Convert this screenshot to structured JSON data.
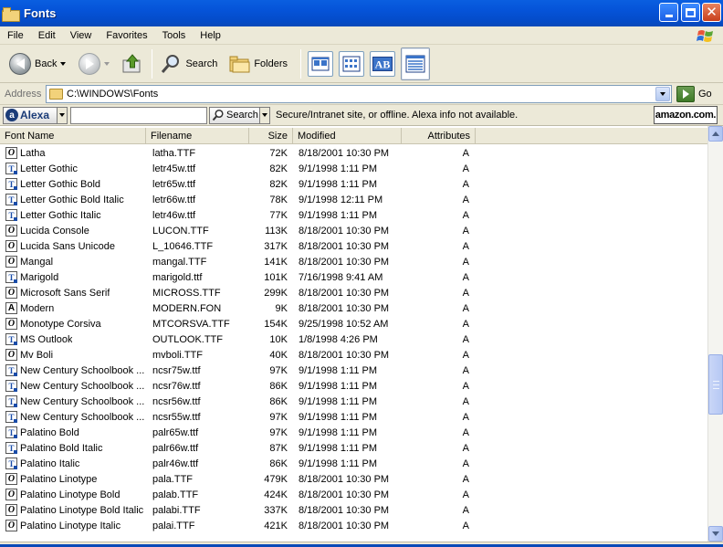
{
  "window": {
    "title": "Fonts"
  },
  "menu": [
    "File",
    "Edit",
    "View",
    "Favorites",
    "Tools",
    "Help"
  ],
  "toolbar": {
    "back_label": "Back",
    "search_label": "Search",
    "folders_label": "Folders"
  },
  "address": {
    "label": "Address",
    "path": "C:\\WINDOWS\\Fonts",
    "go_label": "Go"
  },
  "alexa": {
    "brand": "Alexa",
    "search_placeholder": "",
    "search_label": "Search",
    "status": "Secure/Intranet site, or offline. Alexa info not available.",
    "amazon": "amazon.com."
  },
  "columns": {
    "name": "Font Name",
    "filename": "Filename",
    "size": "Size",
    "modified": "Modified",
    "attributes": "Attributes"
  },
  "fonts": [
    {
      "icon": "opentype-icon",
      "name": "Latha",
      "filename": "latha.TTF",
      "size": "72K",
      "modified": "8/18/2001 10:30 PM",
      "attr": "A"
    },
    {
      "icon": "truetype-icon",
      "name": "Letter Gothic",
      "filename": "letr45w.ttf",
      "size": "82K",
      "modified": "9/1/1998 1:11 PM",
      "attr": "A"
    },
    {
      "icon": "truetype-icon",
      "name": "Letter Gothic Bold",
      "filename": "letr65w.ttf",
      "size": "82K",
      "modified": "9/1/1998 1:11 PM",
      "attr": "A"
    },
    {
      "icon": "truetype-icon",
      "name": "Letter Gothic Bold Italic",
      "filename": "letr66w.ttf",
      "size": "78K",
      "modified": "9/1/1998 12:11 PM",
      "attr": "A"
    },
    {
      "icon": "truetype-icon",
      "name": "Letter Gothic Italic",
      "filename": "letr46w.ttf",
      "size": "77K",
      "modified": "9/1/1998 1:11 PM",
      "attr": "A"
    },
    {
      "icon": "opentype-icon",
      "name": "Lucida Console",
      "filename": "LUCON.TTF",
      "size": "113K",
      "modified": "8/18/2001 10:30 PM",
      "attr": "A"
    },
    {
      "icon": "opentype-icon",
      "name": "Lucida Sans Unicode",
      "filename": "L_10646.TTF",
      "size": "317K",
      "modified": "8/18/2001 10:30 PM",
      "attr": "A"
    },
    {
      "icon": "opentype-icon",
      "name": "Mangal",
      "filename": "mangal.TTF",
      "size": "141K",
      "modified": "8/18/2001 10:30 PM",
      "attr": "A"
    },
    {
      "icon": "truetype-icon",
      "name": "Marigold",
      "filename": "marigold.ttf",
      "size": "101K",
      "modified": "7/16/1998 9:41 AM",
      "attr": "A"
    },
    {
      "icon": "opentype-icon",
      "name": "Microsoft Sans Serif",
      "filename": "MICROSS.TTF",
      "size": "299K",
      "modified": "8/18/2001 10:30 PM",
      "attr": "A"
    },
    {
      "icon": "bitmap-font-icon",
      "name": "Modern",
      "filename": "MODERN.FON",
      "size": "9K",
      "modified": "8/18/2001 10:30 PM",
      "attr": "A"
    },
    {
      "icon": "opentype-icon",
      "name": "Monotype Corsiva",
      "filename": "MTCORSVA.TTF",
      "size": "154K",
      "modified": "9/25/1998 10:52 AM",
      "attr": "A"
    },
    {
      "icon": "truetype-icon",
      "name": "MS Outlook",
      "filename": "OUTLOOK.TTF",
      "size": "10K",
      "modified": "1/8/1998 4:26 PM",
      "attr": "A"
    },
    {
      "icon": "opentype-icon",
      "name": "Mv Boli",
      "filename": "mvboli.TTF",
      "size": "40K",
      "modified": "8/18/2001 10:30 PM",
      "attr": "A"
    },
    {
      "icon": "truetype-icon",
      "name": "New Century Schoolbook ...",
      "filename": "ncsr75w.ttf",
      "size": "97K",
      "modified": "9/1/1998 1:11 PM",
      "attr": "A"
    },
    {
      "icon": "truetype-icon",
      "name": "New Century Schoolbook ...",
      "filename": "ncsr76w.ttf",
      "size": "86K",
      "modified": "9/1/1998 1:11 PM",
      "attr": "A"
    },
    {
      "icon": "truetype-icon",
      "name": "New Century Schoolbook ...",
      "filename": "ncsr56w.ttf",
      "size": "86K",
      "modified": "9/1/1998 1:11 PM",
      "attr": "A"
    },
    {
      "icon": "truetype-icon",
      "name": "New Century Schoolbook ...",
      "filename": "ncsr55w.ttf",
      "size": "97K",
      "modified": "9/1/1998 1:11 PM",
      "attr": "A"
    },
    {
      "icon": "truetype-icon",
      "name": "Palatino Bold",
      "filename": "palr65w.ttf",
      "size": "97K",
      "modified": "9/1/1998 1:11 PM",
      "attr": "A"
    },
    {
      "icon": "truetype-icon",
      "name": "Palatino Bold Italic",
      "filename": "palr66w.ttf",
      "size": "87K",
      "modified": "9/1/1998 1:11 PM",
      "attr": "A"
    },
    {
      "icon": "truetype-icon",
      "name": "Palatino Italic",
      "filename": "palr46w.ttf",
      "size": "86K",
      "modified": "9/1/1998 1:11 PM",
      "attr": "A"
    },
    {
      "icon": "opentype-icon",
      "name": "Palatino Linotype",
      "filename": "pala.TTF",
      "size": "479K",
      "modified": "8/18/2001 10:30 PM",
      "attr": "A"
    },
    {
      "icon": "opentype-icon",
      "name": "Palatino Linotype Bold",
      "filename": "palab.TTF",
      "size": "424K",
      "modified": "8/18/2001 10:30 PM",
      "attr": "A"
    },
    {
      "icon": "opentype-icon",
      "name": "Palatino Linotype Bold Italic",
      "filename": "palabi.TTF",
      "size": "337K",
      "modified": "8/18/2001 10:30 PM",
      "attr": "A"
    },
    {
      "icon": "opentype-icon",
      "name": "Palatino Linotype Italic",
      "filename": "palai.TTF",
      "size": "421K",
      "modified": "8/18/2001 10:30 PM",
      "attr": "A"
    }
  ]
}
